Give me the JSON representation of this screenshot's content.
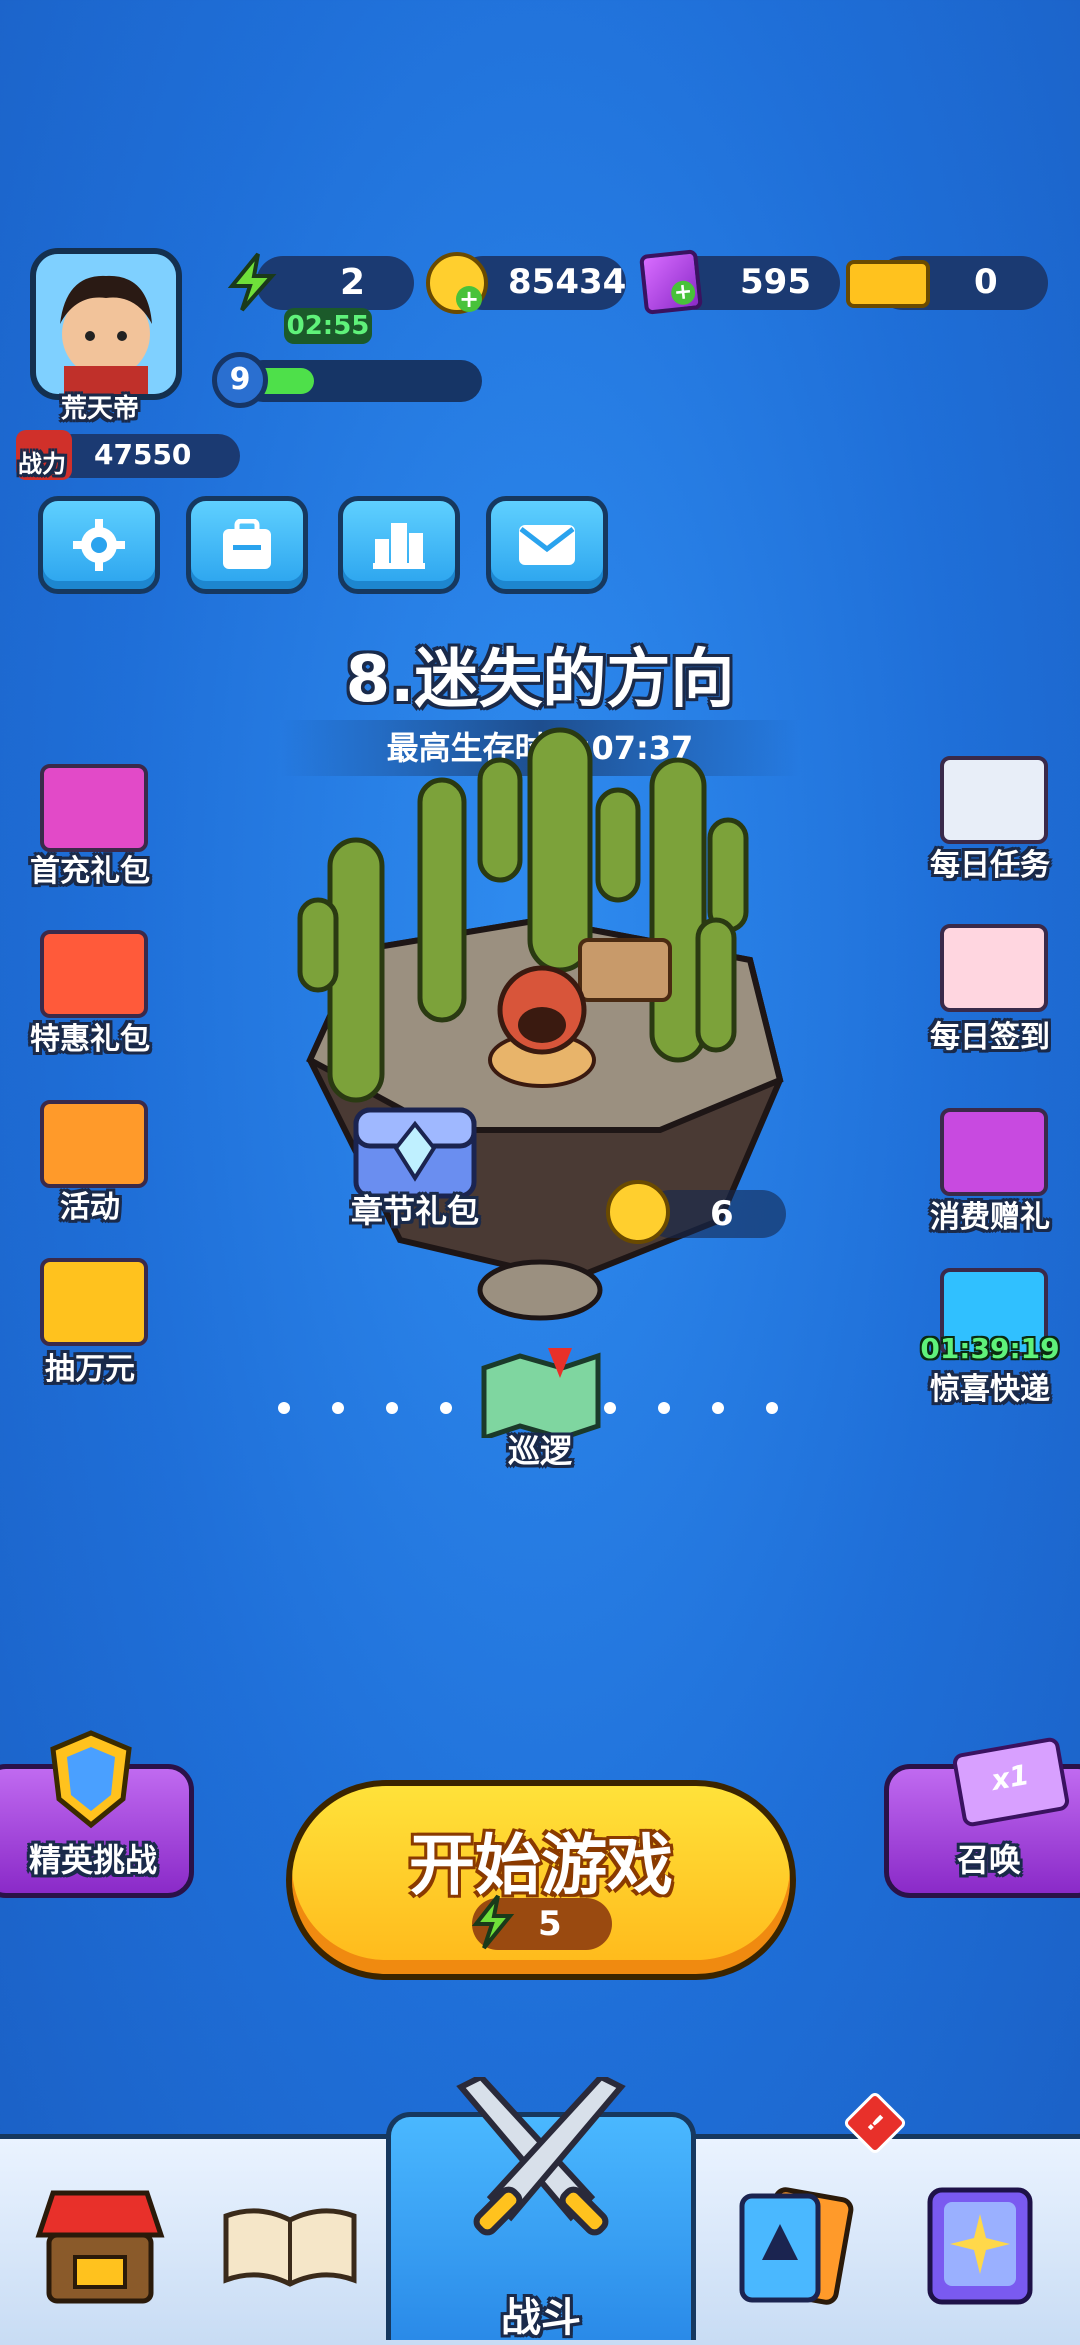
{
  "player": {
    "name": "荒天帝",
    "level": "9",
    "power_label": "战力",
    "power": "47550"
  },
  "resources": {
    "energy": {
      "value": "2",
      "timer": "02:55"
    },
    "coins": {
      "value": "85434"
    },
    "gems": {
      "value": "595"
    },
    "tickets": {
      "value": "0"
    }
  },
  "toolbar": {
    "settings": "gear-icon",
    "inventory": "bag-icon",
    "ranking": "leaderboard-icon",
    "mail": "mail-icon"
  },
  "chapter": {
    "title": "8.迷失的方向",
    "best_time": "最高生存时间:07:37"
  },
  "island": {
    "chest_label": "章节礼包",
    "coin_reward": "6",
    "patrol_label": "巡逻"
  },
  "left_menu": [
    {
      "label": "首充礼包"
    },
    {
      "label": "特惠礼包"
    },
    {
      "label": "活动"
    },
    {
      "label": "抽万元"
    }
  ],
  "right_menu": [
    {
      "label": "每日任务"
    },
    {
      "label": "每日签到"
    },
    {
      "label": "消费赠礼"
    },
    {
      "label": "惊喜快递",
      "timer": "01:39:19"
    }
  ],
  "elite": {
    "label": "精英挑战"
  },
  "summon": {
    "label": "召唤",
    "badge": "x1"
  },
  "start": {
    "label": "开始游戏",
    "cost": "5"
  },
  "nav": {
    "battle_label": "战斗",
    "alert": "!"
  },
  "colors": {
    "accent_yellow": "#ffc21e",
    "purple": "#9b3fd6",
    "bg_blue": "#1f6fd8"
  }
}
